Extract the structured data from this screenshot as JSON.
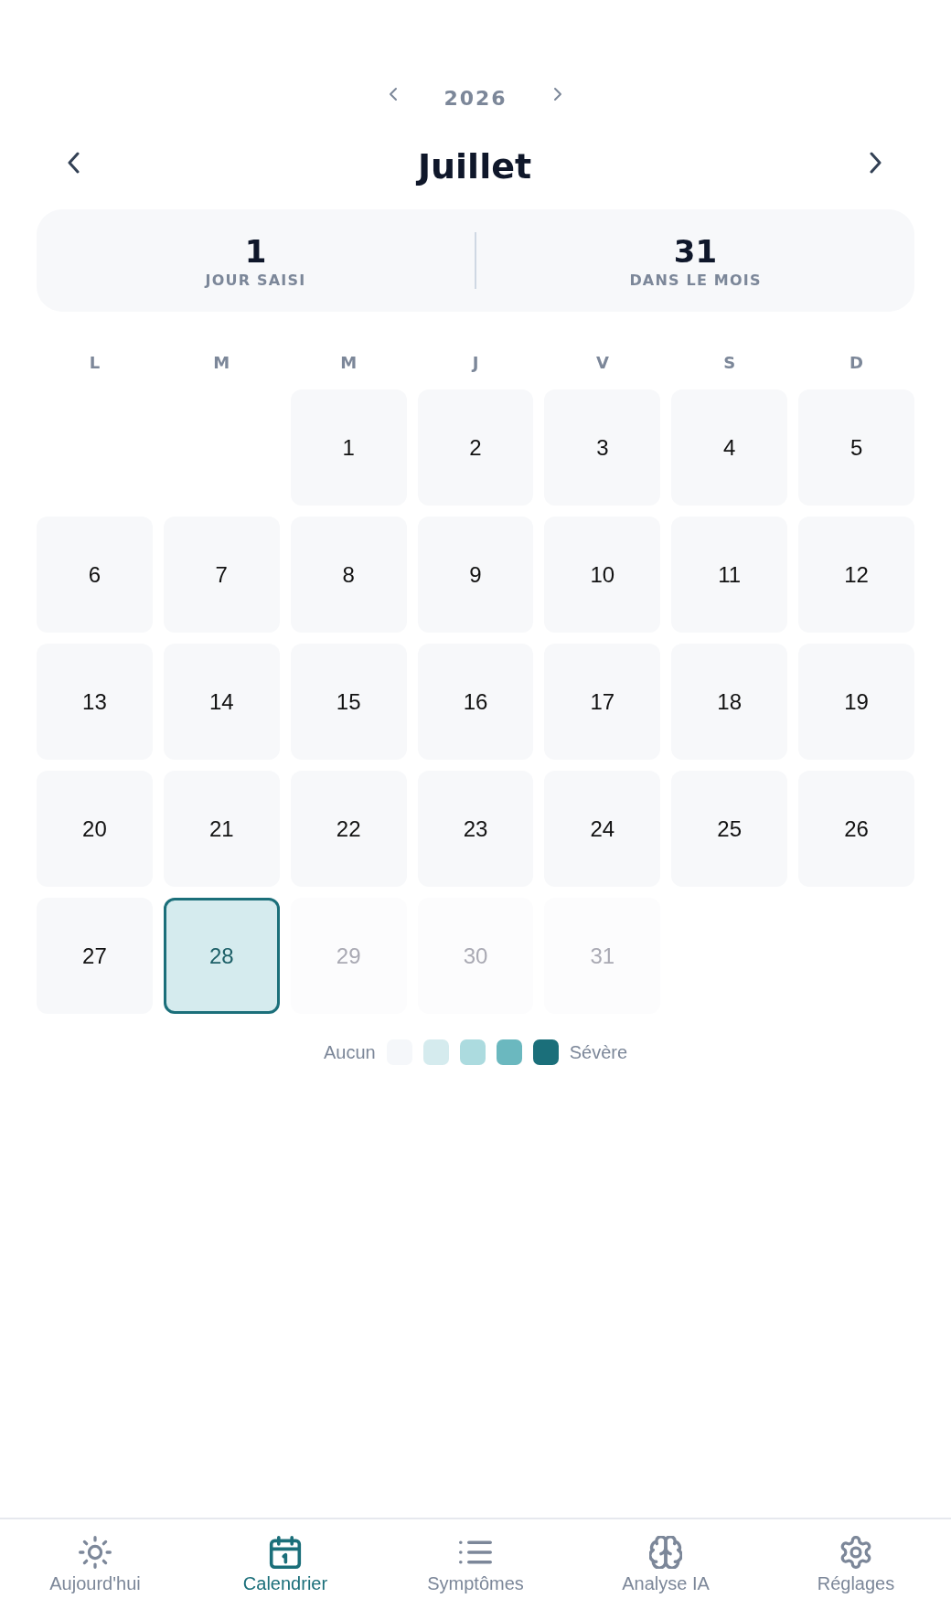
{
  "year_nav": {
    "year": "2026"
  },
  "month_nav": {
    "month": "Juillet"
  },
  "stats": [
    {
      "value": "1",
      "label": "JOUR SAISI"
    },
    {
      "value": "31",
      "label": "DANS LE MOIS"
    }
  ],
  "weekdays": [
    "L",
    "M",
    "M",
    "J",
    "V",
    "S",
    "D"
  ],
  "calendar": {
    "cells": [
      {
        "kind": "blank"
      },
      {
        "kind": "blank"
      },
      {
        "kind": "day",
        "day": "1",
        "selected": false,
        "disabled": false
      },
      {
        "kind": "day",
        "day": "2",
        "selected": false,
        "disabled": false
      },
      {
        "kind": "day",
        "day": "3",
        "selected": false,
        "disabled": false
      },
      {
        "kind": "day",
        "day": "4",
        "selected": false,
        "disabled": false
      },
      {
        "kind": "day",
        "day": "5",
        "selected": false,
        "disabled": false
      },
      {
        "kind": "day",
        "day": "6",
        "selected": false,
        "disabled": false
      },
      {
        "kind": "day",
        "day": "7",
        "selected": false,
        "disabled": false
      },
      {
        "kind": "day",
        "day": "8",
        "selected": false,
        "disabled": false
      },
      {
        "kind": "day",
        "day": "9",
        "selected": false,
        "disabled": false
      },
      {
        "kind": "day",
        "day": "10",
        "selected": false,
        "disabled": false
      },
      {
        "kind": "day",
        "day": "11",
        "selected": false,
        "disabled": false
      },
      {
        "kind": "day",
        "day": "12",
        "selected": false,
        "disabled": false
      },
      {
        "kind": "day",
        "day": "13",
        "selected": false,
        "disabled": false
      },
      {
        "kind": "day",
        "day": "14",
        "selected": false,
        "disabled": false
      },
      {
        "kind": "day",
        "day": "15",
        "selected": false,
        "disabled": false
      },
      {
        "kind": "day",
        "day": "16",
        "selected": false,
        "disabled": false
      },
      {
        "kind": "day",
        "day": "17",
        "selected": false,
        "disabled": false
      },
      {
        "kind": "day",
        "day": "18",
        "selected": false,
        "disabled": false
      },
      {
        "kind": "day",
        "day": "19",
        "selected": false,
        "disabled": false
      },
      {
        "kind": "day",
        "day": "20",
        "selected": false,
        "disabled": false
      },
      {
        "kind": "day",
        "day": "21",
        "selected": false,
        "disabled": false
      },
      {
        "kind": "day",
        "day": "22",
        "selected": false,
        "disabled": false
      },
      {
        "kind": "day",
        "day": "23",
        "selected": false,
        "disabled": false
      },
      {
        "kind": "day",
        "day": "24",
        "selected": false,
        "disabled": false
      },
      {
        "kind": "day",
        "day": "25",
        "selected": false,
        "disabled": false
      },
      {
        "kind": "day",
        "day": "26",
        "selected": false,
        "disabled": false
      },
      {
        "kind": "day",
        "day": "27",
        "selected": false,
        "disabled": false
      },
      {
        "kind": "day",
        "day": "28",
        "selected": true,
        "disabled": false
      },
      {
        "kind": "day",
        "day": "29",
        "selected": false,
        "disabled": true
      },
      {
        "kind": "day",
        "day": "30",
        "selected": false,
        "disabled": true
      },
      {
        "kind": "day",
        "day": "31",
        "selected": false,
        "disabled": true
      }
    ]
  },
  "legend": {
    "low_label": "Aucun",
    "swatches": [
      {
        "color": "#f5f7fa"
      },
      {
        "color": "#d5ebee"
      },
      {
        "color": "#acdbdf"
      },
      {
        "color": "#6bb8bf"
      },
      {
        "color": "#1b6f7a"
      }
    ],
    "high_label": "Sévère"
  },
  "tab_bar": {
    "tabs": [
      {
        "label": "Aujourd'hui",
        "selected": false
      },
      {
        "label": "Calendrier",
        "selected": true
      },
      {
        "label": "Symptômes",
        "selected": false
      },
      {
        "label": "Analyse IA",
        "selected": false
      },
      {
        "label": "Réglages",
        "selected": false
      }
    ]
  }
}
